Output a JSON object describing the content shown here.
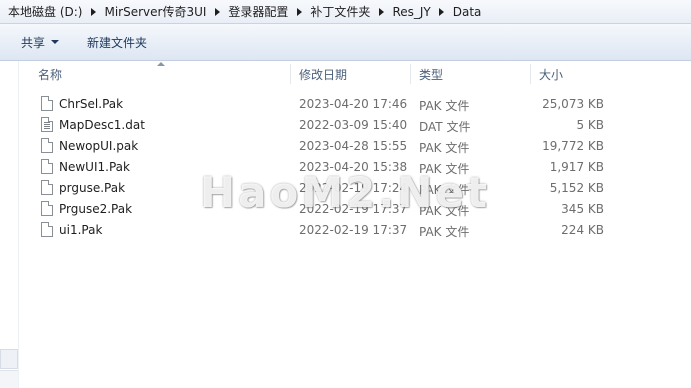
{
  "breadcrumb": [
    "本地磁盘 (D:)",
    "MirServer传奇3UI",
    "登录器配置",
    "补丁文件夹",
    "Res_JY",
    "Data"
  ],
  "toolbar": {
    "share_label": "共享",
    "new_folder_label": "新建文件夹"
  },
  "columns": {
    "name": "名称",
    "date": "修改日期",
    "type": "类型",
    "size": "大小"
  },
  "files": [
    {
      "name": "ChrSel.Pak",
      "date": "2023-04-20 17:46",
      "type": "PAK 文件",
      "size": "25,073 KB",
      "icon": "file-icon"
    },
    {
      "name": "MapDesc1.dat",
      "date": "2022-03-09 15:40",
      "type": "DAT 文件",
      "size": "5 KB",
      "icon": "text-file-icon"
    },
    {
      "name": "NewopUI.pak",
      "date": "2023-04-28 15:55",
      "type": "PAK 文件",
      "size": "19,772 KB",
      "icon": "file-icon"
    },
    {
      "name": "NewUI1.Pak",
      "date": "2023-04-20 15:38",
      "type": "PAK 文件",
      "size": "1,917 KB",
      "icon": "file-icon"
    },
    {
      "name": "prguse.Pak",
      "date": "2022-02-19 17:24",
      "type": "PAK 文件",
      "size": "5,152 KB",
      "icon": "file-icon"
    },
    {
      "name": "Prguse2.Pak",
      "date": "2022-02-19 17:37",
      "type": "PAK 文件",
      "size": "345 KB",
      "icon": "file-icon"
    },
    {
      "name": "ui1.Pak",
      "date": "2022-02-19 17:37",
      "type": "PAK 文件",
      "size": "224 KB",
      "icon": "file-icon"
    }
  ],
  "watermark": "HaoM2.Net"
}
